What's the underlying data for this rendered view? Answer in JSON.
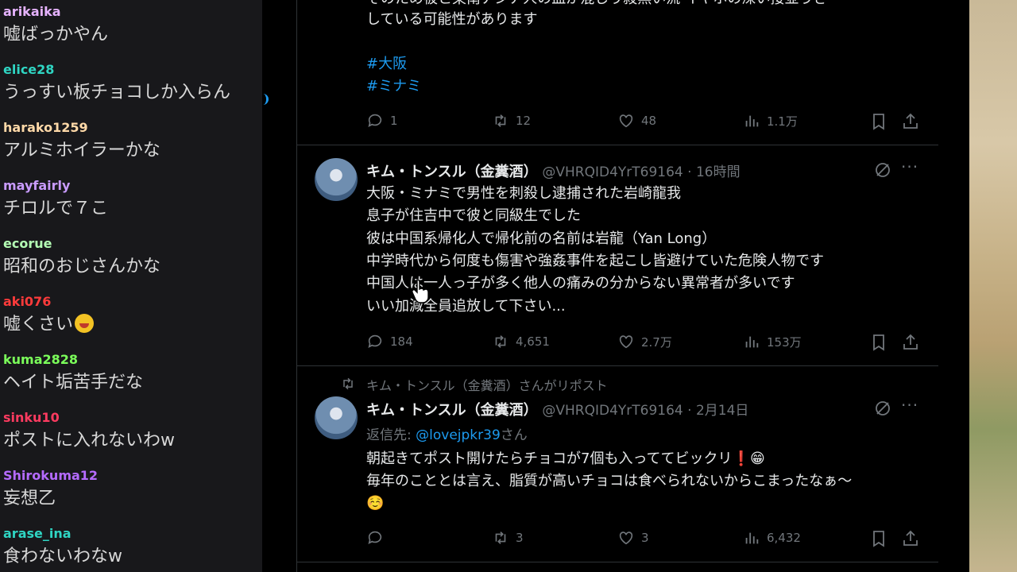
{
  "chat": {
    "messages": [
      {
        "user": "arikaika",
        "color": "#e6b3ff",
        "text": "嘘ばっかやん",
        "emoji": false
      },
      {
        "user": "elice28",
        "color": "#2fd5c3",
        "text": "うっすい板チョコしか入らん",
        "emoji": false
      },
      {
        "user": "harako1259",
        "color": "#ffd9a8",
        "text": "アルミホイラーかな",
        "emoji": false
      },
      {
        "user": "mayfairly",
        "color": "#c99bff",
        "text": "チロルで７こ",
        "emoji": false
      },
      {
        "user": "ecorue",
        "color": "#b4ffb4",
        "text": "昭和のおじさんかな",
        "emoji": false
      },
      {
        "user": "aki076",
        "color": "#ff3b3b",
        "text": "嘘くさい",
        "emoji": true
      },
      {
        "user": "kuma2828",
        "color": "#7bff5a",
        "text": "ヘイト垢苦手だな",
        "emoji": false
      },
      {
        "user": "sinku10",
        "color": "#ff3b60",
        "text": "ポストに入れないわw",
        "emoji": false
      },
      {
        "user": "Shirokuma12",
        "color": "#b56bff",
        "text": "妄想乙",
        "emoji": false
      },
      {
        "user": "arase_ina",
        "color": "#2fd5c3",
        "text": "食わないわなw",
        "emoji": false
      }
    ]
  },
  "tweets": [
    {
      "lines": [
        "そのため被と東南アジア人の血が混じり殺無い流  イヤホの深い接並うさ",
        "している可能性があります"
      ],
      "hashtags": [
        "#大阪",
        "#ミナミ"
      ],
      "stats": {
        "reply": "1",
        "repost": "12",
        "like": "48",
        "views": "1.1万"
      }
    },
    {
      "author": "キム・トンスル（金糞酒）",
      "handle": "@VHRQID4YrT69164",
      "time": "16時間",
      "lines": [
        "大阪・ミナミで男性を刺殺し逮捕された岩崎龍我",
        "息子が住吉中で彼と同級生でした",
        "彼は中国系帰化人で帰化前の名前は岩龍（Yan Long）",
        "中学時代から何度も傷害や強姦事件を起こし皆避けていた危険人物です",
        "中国人は一人っ子が多く他人の痛みの分からない異常者が多いです",
        "いい加減全員追放して下さい..."
      ],
      "stats": {
        "reply": "184",
        "repost": "4,651",
        "like": "2.7万",
        "views": "153万"
      }
    },
    {
      "repost_label": "キム・トンスル（金糞酒）さんがリポスト",
      "author": "キム・トンスル（金糞酒）",
      "handle": "@VHRQID4YrT69164",
      "time": "2月14日",
      "reply_prefix": "返信先: ",
      "reply_handle": "@lovejpkr39",
      "reply_suffix": "さん",
      "lines": [
        "朝起きてポスト開けたらチョコが7個も入っててビックリ❗😁",
        "毎年のこととは言え、脂質が高いチョコは食べられないからこまったなぁ〜",
        "☺️"
      ],
      "stats": {
        "reply": "",
        "repost": "3",
        "like": "3",
        "views": "6,432"
      }
    }
  ],
  "separator": " · "
}
